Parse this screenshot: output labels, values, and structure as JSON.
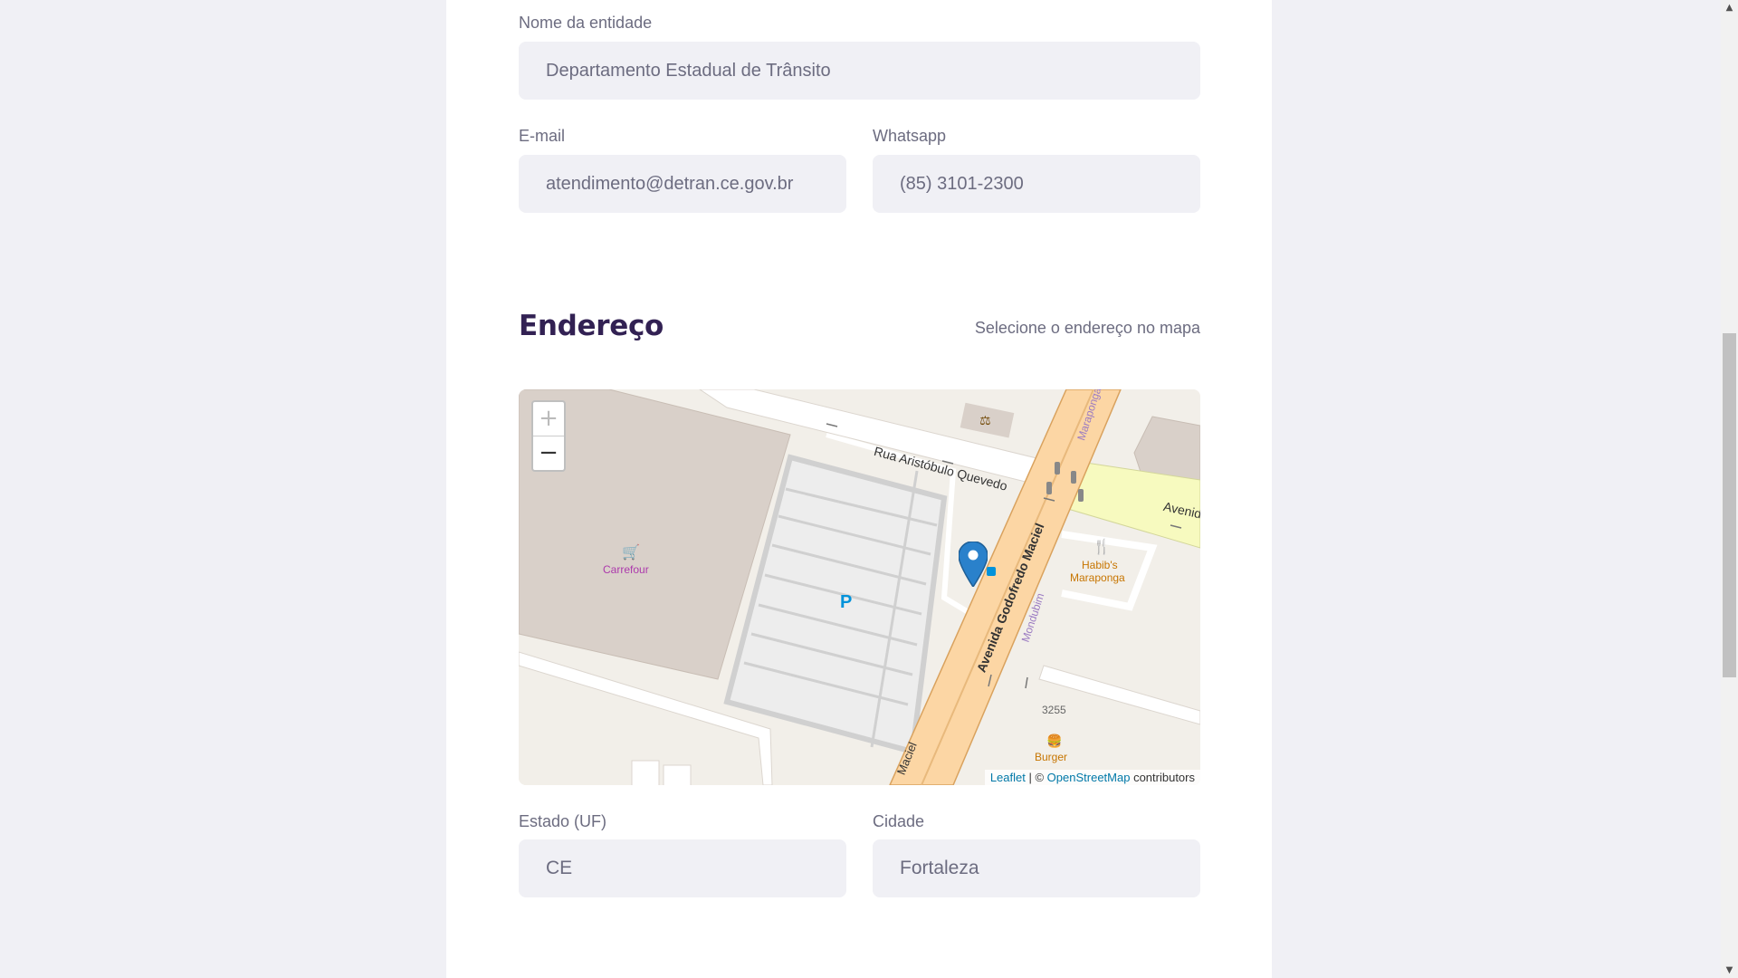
{
  "entity": {
    "name_label": "Nome da entidade",
    "name_value": "Departamento Estadual de Trânsito",
    "email_label": "E-mail",
    "email_value": "atendimento@detran.ce.gov.br",
    "whatsapp_label": "Whatsapp",
    "whatsapp_value": "(85) 3101-2300"
  },
  "address": {
    "title": "Endereço",
    "hint": "Selecione o endereço no mapa",
    "state_label": "Estado (UF)",
    "state_value": "CE",
    "city_label": "Cidade",
    "city_value": "Fortaleza"
  },
  "map": {
    "zoom_in": "+",
    "zoom_out": "−",
    "attribution_leaflet": "Leaflet",
    "attribution_sep": " | © ",
    "attribution_osm": "OpenStreetMap",
    "attribution_suffix": " contributors",
    "labels": {
      "street_top": "Rua Aristóbulo Quevedo",
      "avenue_main": "Avenida Godofredo Maciel",
      "avenue_main_bottom": "Maciel",
      "avenue_right": "Avenida",
      "mondubim": "Mondubim",
      "maraponga": "Maraponga",
      "carrefour": "Carrefour",
      "habibs": "Habib's",
      "habibs_2": "Maraponga",
      "burger": "Burger",
      "number": "3255",
      "parking": "P"
    },
    "colors": {
      "background": "#f2efe9",
      "building": "#d9d0c9",
      "road_major": "#fcd6a4",
      "road_secondary": "#f7fabf",
      "marker": "#2a81cb"
    }
  },
  "colors": {
    "page_bg": "#f0f0f5",
    "input_bg": "#f0f0f5",
    "title": "#322153",
    "text": "#6c6c80"
  }
}
